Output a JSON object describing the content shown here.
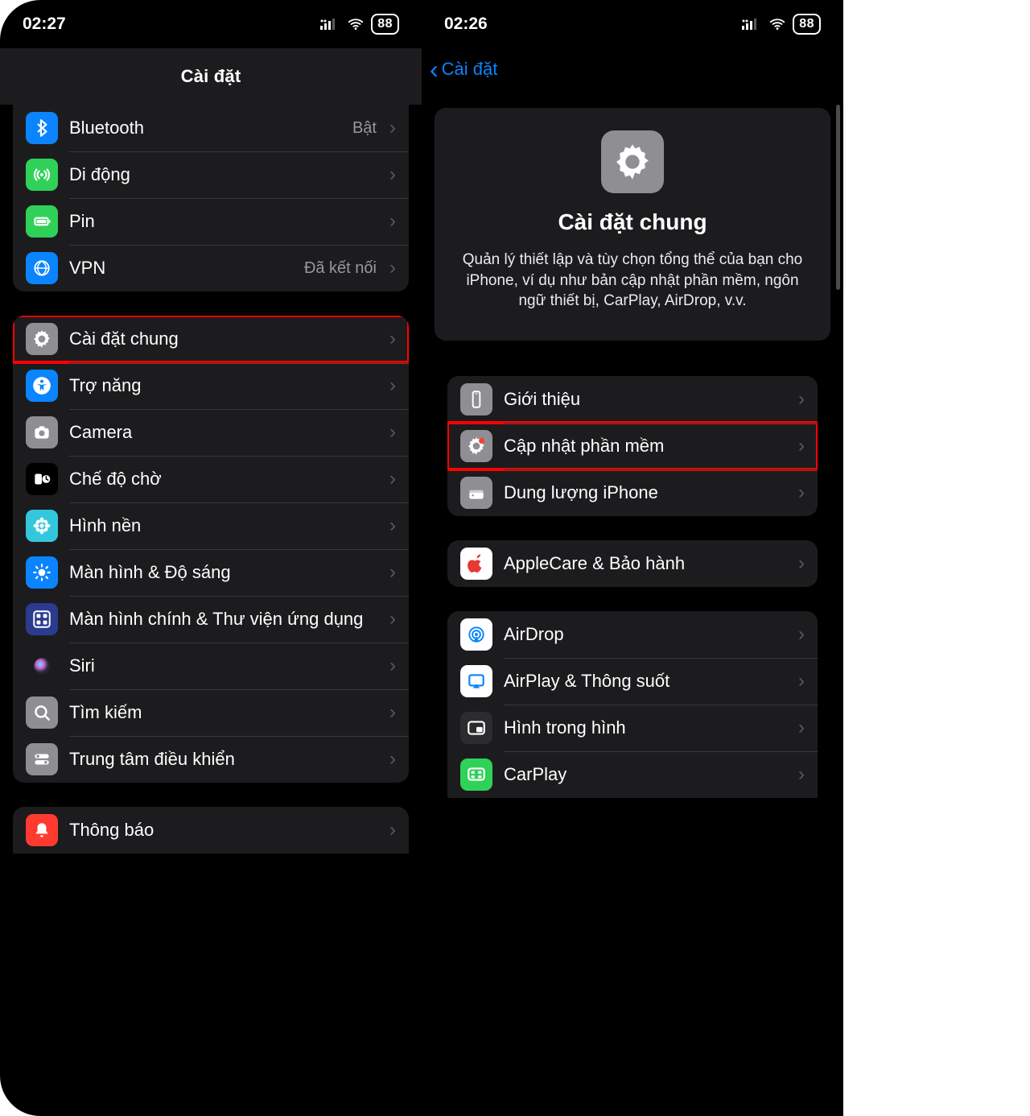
{
  "left": {
    "statusbar": {
      "time": "02:27",
      "battery": "88"
    },
    "title": "Cài đặt",
    "group1": [
      {
        "name": "bluetooth",
        "label": "Bluetooth",
        "value": "Bật",
        "icon": "bt",
        "bg": "#0a84ff"
      },
      {
        "name": "cellular",
        "label": "Di động",
        "value": "",
        "icon": "antenna",
        "bg": "#30d158"
      },
      {
        "name": "battery",
        "label": "Pin",
        "value": "",
        "icon": "batt",
        "bg": "#30d158"
      },
      {
        "name": "vpn",
        "label": "VPN",
        "value": "Đã kết nối",
        "icon": "globe",
        "bg": "#0a84ff"
      }
    ],
    "group2": [
      {
        "name": "general",
        "label": "Cài đặt chung",
        "icon": "gear",
        "bg": "#8e8e93",
        "highlight": true
      },
      {
        "name": "accessibility",
        "label": "Trợ năng",
        "icon": "access",
        "bg": "#0a84ff"
      },
      {
        "name": "camera",
        "label": "Camera",
        "icon": "cam",
        "bg": "#8e8e93"
      },
      {
        "name": "standby",
        "label": "Chế độ chờ",
        "icon": "standby",
        "bg": "#000000"
      },
      {
        "name": "wallpaper",
        "label": "Hình nền",
        "icon": "flower",
        "bg": "#33c7de"
      },
      {
        "name": "display",
        "label": "Màn hình & Độ sáng",
        "icon": "sun",
        "bg": "#0a84ff"
      },
      {
        "name": "home",
        "label": "Màn hình chính & Thư viện ứng dụng",
        "icon": "grid",
        "bg": "#2b3b8f"
      },
      {
        "name": "siri",
        "label": "Siri",
        "icon": "siri",
        "bg": "#1c1c1e"
      },
      {
        "name": "search",
        "label": "Tìm kiếm",
        "icon": "search",
        "bg": "#8e8e93"
      },
      {
        "name": "control",
        "label": "Trung tâm điều khiển",
        "icon": "switches",
        "bg": "#8e8e93"
      }
    ],
    "group3": [
      {
        "name": "notifications",
        "label": "Thông báo",
        "icon": "bell",
        "bg": "#ff3b30"
      }
    ]
  },
  "right": {
    "statusbar": {
      "time": "02:26",
      "battery": "88"
    },
    "back_label": "Cài đặt",
    "hero": {
      "title": "Cài đặt chung",
      "desc": "Quản lý thiết lập và tùy chọn tổng thể của bạn cho iPhone, ví dụ như bản cập nhật phần mềm, ngôn ngữ thiết bị, CarPlay, AirDrop, v.v."
    },
    "group1": [
      {
        "name": "about",
        "label": "Giới thiệu",
        "icon": "phone",
        "bg": "#8e8e93"
      },
      {
        "name": "update",
        "label": "Cập nhật phần mềm",
        "icon": "gearbadge",
        "bg": "#8e8e93",
        "highlight": true
      },
      {
        "name": "storage",
        "label": "Dung lượng iPhone",
        "icon": "drive",
        "bg": "#8e8e93"
      }
    ],
    "group2": [
      {
        "name": "applecare",
        "label": "AppleCare & Bảo hành",
        "icon": "apple",
        "bg": "#ffffff"
      }
    ],
    "group3": [
      {
        "name": "airdrop",
        "label": "AirDrop",
        "icon": "airdrop",
        "bg": "#ffffff"
      },
      {
        "name": "airplay",
        "label": "AirPlay & Thông suốt",
        "icon": "airplay",
        "bg": "#ffffff"
      },
      {
        "name": "pip",
        "label": "Hình trong hình",
        "icon": "pip",
        "bg": "#2c2c2e"
      },
      {
        "name": "carplay",
        "label": "CarPlay",
        "icon": "carplay",
        "bg": "#30d158"
      }
    ]
  }
}
